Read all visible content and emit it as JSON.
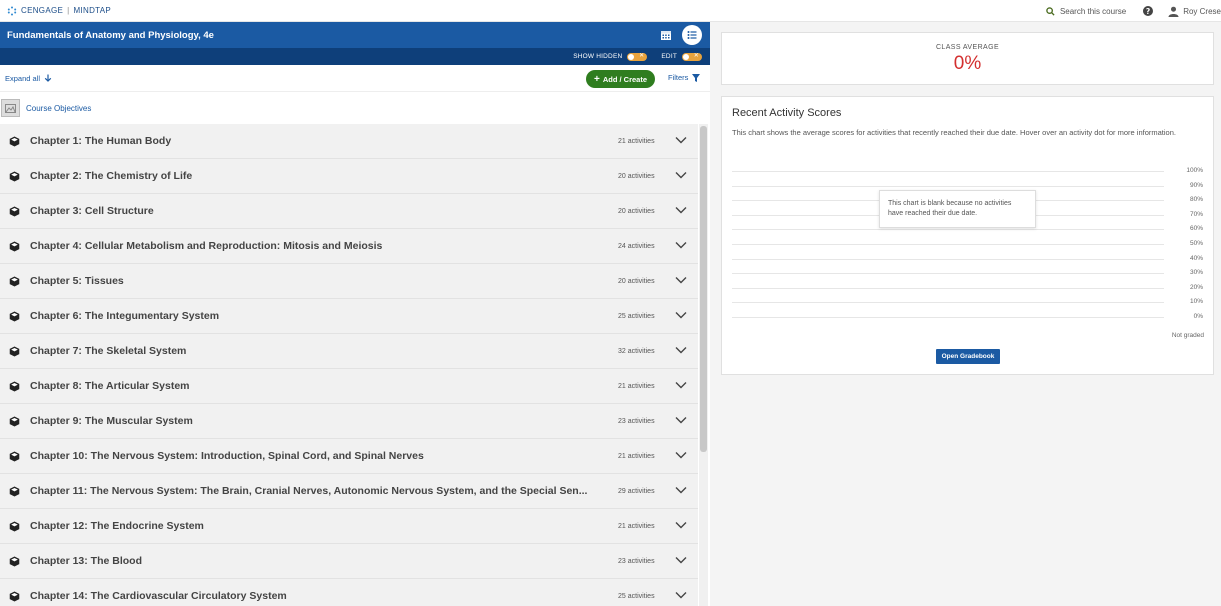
{
  "brand": {
    "name": "CENGAGE",
    "product": "MINDTAP"
  },
  "topbar": {
    "search_label": "Search this course",
    "user_name": "Roy Crese"
  },
  "course": {
    "title": "Fundamentals of Anatomy and Physiology, 4e"
  },
  "toggles": {
    "show_hidden_label": "SHOW HIDDEN",
    "edit_label": "EDIT"
  },
  "actions": {
    "expand_all": "Expand all",
    "add_create": "Add / Create",
    "filters": "Filters"
  },
  "objectives": {
    "label": "Course Objectives"
  },
  "chapters": [
    {
      "title": "Chapter 1: The Human Body",
      "count": "21 activities"
    },
    {
      "title": "Chapter 2: The Chemistry of Life",
      "count": "20 activities"
    },
    {
      "title": "Chapter 3: Cell Structure",
      "count": "20 activities"
    },
    {
      "title": "Chapter 4: Cellular Metabolism and Reproduction: Mitosis and Meiosis",
      "count": "24 activities"
    },
    {
      "title": "Chapter 5: Tissues",
      "count": "20 activities"
    },
    {
      "title": "Chapter 6: The Integumentary System",
      "count": "25 activities"
    },
    {
      "title": "Chapter 7: The Skeletal System",
      "count": "32 activities"
    },
    {
      "title": "Chapter 8: The Articular System",
      "count": "21 activities"
    },
    {
      "title": "Chapter 9: The Muscular System",
      "count": "23 activities"
    },
    {
      "title": "Chapter 10: The Nervous System: Introduction, Spinal Cord, and Spinal Nerves",
      "count": "21 activities"
    },
    {
      "title": "Chapter 11: The Nervous System: The Brain, Cranial Nerves, Autonomic Nervous System, and the Special Sen...",
      "count": "29 activities"
    },
    {
      "title": "Chapter 12: The Endocrine System",
      "count": "21 activities"
    },
    {
      "title": "Chapter 13: The Blood",
      "count": "23 activities"
    },
    {
      "title": "Chapter 14: The Cardiovascular Circulatory System",
      "count": "25 activities"
    }
  ],
  "class_average": {
    "label": "CLASS AVERAGE",
    "value": "0%"
  },
  "scores": {
    "title": "Recent Activity Scores",
    "description": "This chart shows the average scores for activities that recently reached their due date. Hover over an activity dot for more information.",
    "ticks": [
      "100%",
      "90%",
      "80%",
      "70%",
      "60%",
      "50%",
      "40%",
      "30%",
      "20%",
      "10%",
      "0%"
    ],
    "empty_message": "This chart is blank because no activities have reached their due date.",
    "not_graded": "Not graded",
    "open_gradebook": "Open Gradebook"
  },
  "colors": {
    "header_blue": "#1b5aa3",
    "header_dark": "#0e3f7a",
    "add_green": "#2f7d1f",
    "avg_red": "#d32f2f",
    "toggle_orange": "#e8a33d"
  }
}
